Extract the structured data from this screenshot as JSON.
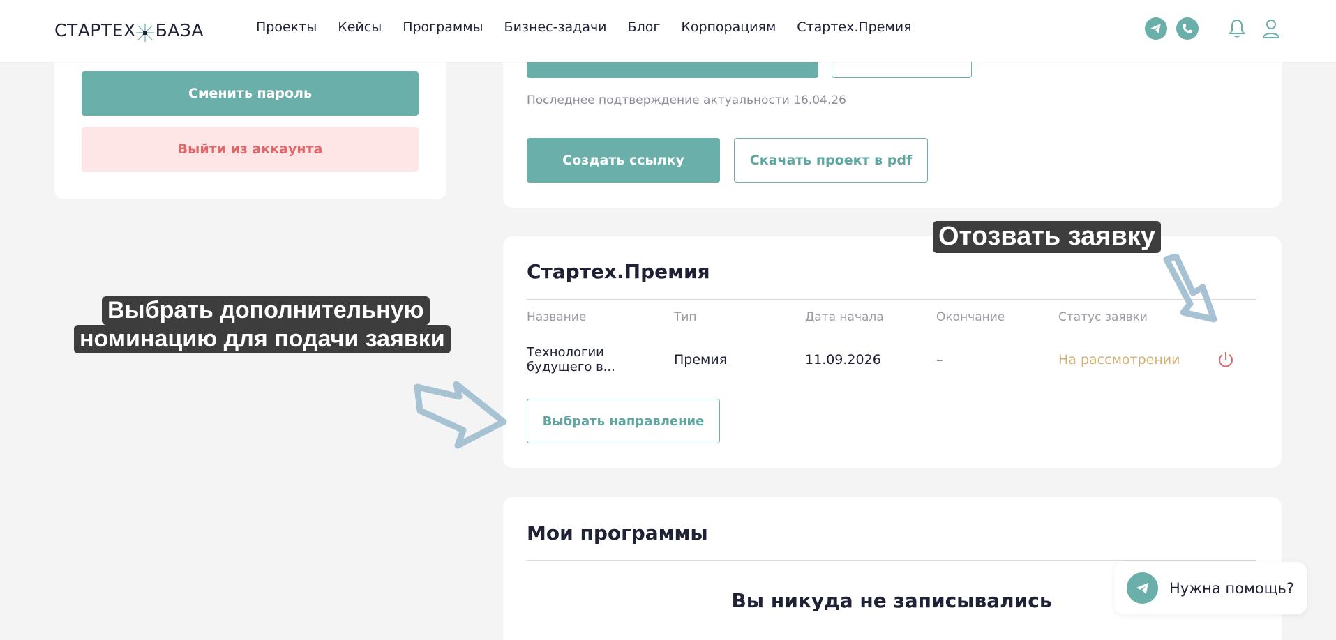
{
  "header": {
    "logo_left": "СТАРТЕХ",
    "logo_right": "БАЗА",
    "nav": [
      "Проекты",
      "Кейсы",
      "Программы",
      "Бизнес-задачи",
      "Блог",
      "Корпорациям",
      "Стартех.Премия"
    ]
  },
  "profile_card": {
    "change_password": "Сменить пароль",
    "logout": "Выйти из аккаунта"
  },
  "project_card": {
    "last_confirm": "Последнее подтверждение актуальности 16.04.26",
    "create_link": "Создать ссылку",
    "download_pdf": "Скачать проект в pdf"
  },
  "premium": {
    "title": "Стартех.Премия",
    "columns": [
      "Название",
      "Тип",
      "Дата начала",
      "Окончание",
      "Статус заявки"
    ],
    "row": {
      "name_line1": "Технологии",
      "name_line2": "будущего в...",
      "type": "Премия",
      "start": "11.09.2026",
      "end": "–",
      "status": "На рассмотрении"
    },
    "choose_direction": "Выбрать направление"
  },
  "programs": {
    "title": "Мои программы",
    "empty": "Вы никуда не записывались"
  },
  "help": {
    "label": "Нужна помощь?"
  },
  "annotations": {
    "withdraw": "Отозвать заявку",
    "choose_line1": "Выбрать дополнительную",
    "choose_line2": "номинацию для подачи заявки"
  },
  "colors": {
    "accent": "#6aafa9",
    "status_pending": "#d4b173",
    "danger": "#e0686a"
  },
  "icons": [
    "telegram-icon",
    "phone-icon",
    "bell-icon",
    "user-icon",
    "power-icon"
  ]
}
